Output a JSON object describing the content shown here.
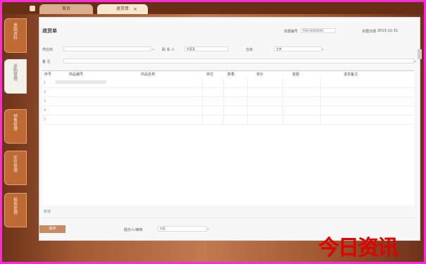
{
  "tabs": {
    "inactive": "首页",
    "active": "退货单",
    "close": "×"
  },
  "sidebar": [
    {
      "label": "基础资料",
      "active": false
    },
    {
      "label": "采购管理",
      "active": true
    },
    {
      "label": "销售管理",
      "active": false
    },
    {
      "label": "库存管理",
      "active": false
    },
    {
      "label": "报表管理",
      "active": false
    }
  ],
  "page": {
    "title": "退货单",
    "doc_no_label": "单据编号",
    "doc_no_value": "PSD-00000001",
    "date_label": "单据日期",
    "date_value": "2013-12-31"
  },
  "filters": {
    "supplier_label": "供应商",
    "supplier_value": "",
    "contact_label": "联 系 人",
    "contact_value": "刘某某",
    "warehouse_label": "仓库",
    "warehouse_value": "主库",
    "remark_label": "备  注",
    "remark_value": ""
  },
  "table": {
    "headers": [
      "序号",
      "商品编号",
      "商品名称",
      "单位",
      "数量",
      "单价",
      "金额",
      "退货备注"
    ],
    "rows": [
      "1",
      "2",
      "3",
      "4",
      "5"
    ]
  },
  "footer": {
    "add_row": "新增",
    "save": "保存",
    "operator_label": "经办人/审核",
    "operator_value": "刘某"
  },
  "watermark": "今日资讯"
}
